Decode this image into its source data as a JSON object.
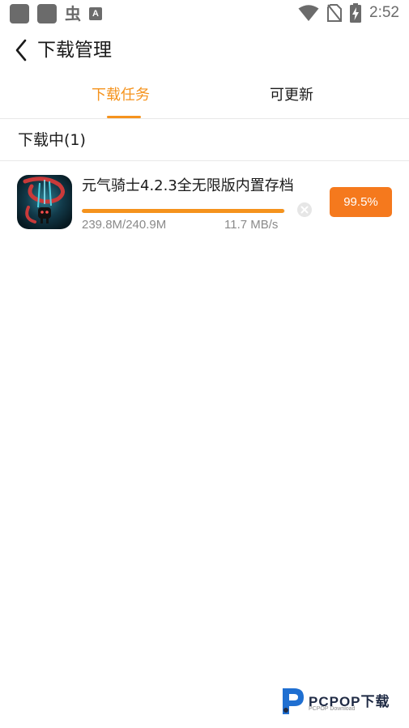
{
  "status_bar": {
    "time": "2:52",
    "left_icons": [
      "app-square-icon",
      "app-square-icon",
      "bug-icon",
      "text-icon"
    ],
    "right_icons": [
      "wifi-icon",
      "no-sim-icon",
      "battery-charging-icon"
    ],
    "glyph_a": "A",
    "glyph_bug": "虫"
  },
  "header": {
    "title": "下载管理"
  },
  "tabs": [
    {
      "label": "下载任务",
      "active": true
    },
    {
      "label": "可更新",
      "active": false
    }
  ],
  "section": {
    "title": "下载中(1)"
  },
  "download": {
    "app_name": "元气骑士4.2.3全无限版内置存档",
    "size": "239.8M/240.9M",
    "speed": "11.7 MB/s",
    "percent_label": "99.5%",
    "progress": 0.995
  },
  "watermark": {
    "brand": "PCPOP下载",
    "sub": "PCPOP Download"
  },
  "colors": {
    "accent": "#f5931d",
    "button": "#f5791d",
    "status_icon": "#6b6b6b"
  }
}
